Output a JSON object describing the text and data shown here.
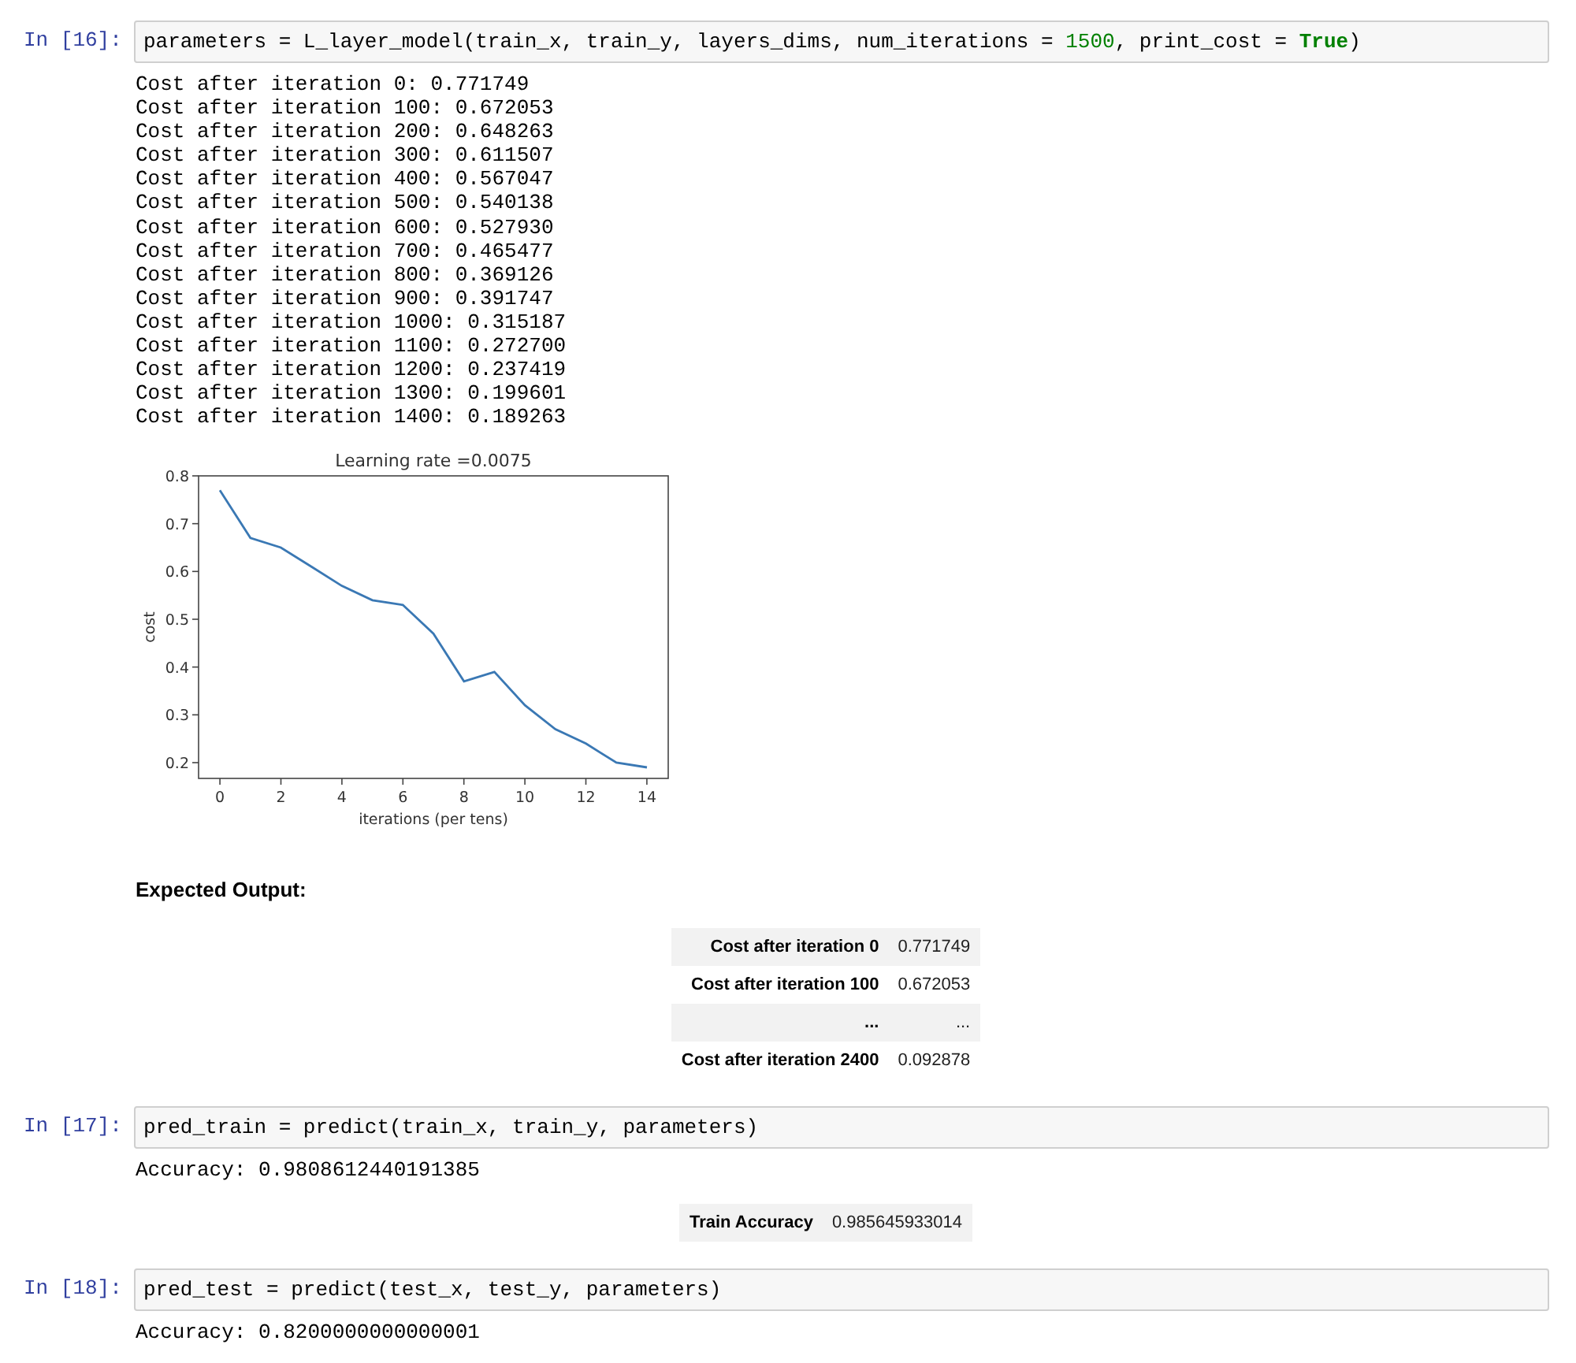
{
  "cells": [
    {
      "prompt": "In [16]:",
      "code": [
        {
          "kind": "plain",
          "text": "parameters = L_layer_model(train_x, train_y, layers_dims, num_iterations = "
        },
        {
          "kind": "number",
          "text": "1500"
        },
        {
          "kind": "plain",
          "text": ", print_cost = "
        },
        {
          "kind": "keyword",
          "text": "True"
        },
        {
          "kind": "plain",
          "text": ")"
        }
      ],
      "outputs": [
        {
          "kind": "stream",
          "lines": [
            "Cost after iteration 0: 0.771749",
            "Cost after iteration 100: 0.672053",
            "Cost after iteration 200: 0.648263",
            "Cost after iteration 300: 0.611507",
            "Cost after iteration 400: 0.567047",
            "Cost after iteration 500: 0.540138",
            "Cost after iteration 600: 0.527930",
            "Cost after iteration 700: 0.465477",
            "Cost after iteration 800: 0.369126",
            "Cost after iteration 900: 0.391747",
            "Cost after iteration 1000: 0.315187",
            "Cost after iteration 1100: 0.272700",
            "Cost after iteration 1200: 0.237419",
            "Cost after iteration 1300: 0.199601",
            "Cost after iteration 1400: 0.189263"
          ]
        },
        {
          "kind": "chart",
          "chart_data": {
            "type": "line",
            "title": "Learning rate =0.0075",
            "xlabel": "iterations (per tens)",
            "ylabel": "cost",
            "x": [
              0,
              1,
              2,
              3,
              4,
              5,
              6,
              7,
              8,
              9,
              10,
              11,
              12,
              13,
              14
            ],
            "series": [
              {
                "color": "#3a78b4",
                "values": [
                  0.77,
                  0.67,
                  0.65,
                  0.61,
                  0.57,
                  0.54,
                  0.53,
                  0.47,
                  0.37,
                  0.39,
                  0.32,
                  0.27,
                  0.24,
                  0.2,
                  0.19
                ]
              }
            ],
            "xlim": [
              -0.7,
              14.7
            ],
            "ylim": [
              0.167,
              0.8
            ],
            "xticks": [
              0,
              2,
              4,
              6,
              8,
              10,
              12,
              14
            ],
            "yticks": [
              0.2,
              0.3,
              0.4,
              0.5,
              0.6,
              0.7,
              0.8
            ]
          }
        },
        {
          "kind": "heading",
          "text": "Expected Output:"
        },
        {
          "kind": "table",
          "rows": [
            {
              "label": "Cost after iteration 0",
              "value": "0.771749"
            },
            {
              "label": "Cost after iteration 100",
              "value": "0.672053"
            },
            {
              "label": "...",
              "value": "..."
            },
            {
              "label": "Cost after iteration 2400",
              "value": "0.092878"
            }
          ]
        }
      ]
    },
    {
      "prompt": "In [17]:",
      "code": [
        {
          "kind": "plain",
          "text": "pred_train = predict(train_x, train_y, parameters)"
        }
      ],
      "outputs": [
        {
          "kind": "stream",
          "lines": [
            "Accuracy: 0.9808612440191385"
          ]
        },
        {
          "kind": "table",
          "rows": [
            {
              "label": "Train Accuracy",
              "value": "0.985645933014"
            }
          ]
        }
      ]
    },
    {
      "prompt": "In [18]:",
      "code": [
        {
          "kind": "plain",
          "text": "pred_test = predict(test_x, test_y, parameters)"
        }
      ],
      "outputs": [
        {
          "kind": "stream",
          "lines": [
            "Accuracy: 0.8200000000000001"
          ]
        }
      ]
    }
  ]
}
